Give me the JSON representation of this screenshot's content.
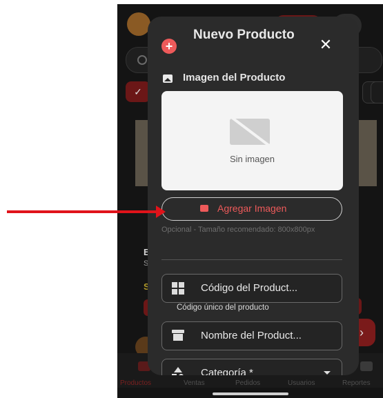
{
  "modal": {
    "title": "Nuevo Producto",
    "close_icon": "close-icon",
    "image_section_label": "Imagen del Producto",
    "image_placeholder_text": "Sin imagen",
    "add_image_label": "Agregar Imagen",
    "image_hint": "Opcional - Tamaño recomendado: 800x800px",
    "fields": {
      "code": {
        "label": "Código del Product...",
        "helper": "Código único del producto",
        "icon": "qr-code-icon"
      },
      "name": {
        "label": "Nombre del Product...",
        "icon": "inventory-box-icon"
      },
      "category": {
        "label": "Categoría *",
        "icon": "category-icon"
      }
    }
  },
  "bottom_nav": {
    "items": [
      {
        "label": "Productos",
        "active": true
      },
      {
        "label": "Ventas"
      },
      {
        "label": "Pedidos"
      },
      {
        "label": "Usuarios"
      },
      {
        "label": "Reportes"
      }
    ]
  },
  "background": {
    "help_label": "?",
    "fragments": [
      "E",
      "S",
      "S"
    ]
  },
  "colors": {
    "accent": "#ee5a5a",
    "modal_bg": "#2b2b2b",
    "annotation_arrow": "#e0131a"
  }
}
